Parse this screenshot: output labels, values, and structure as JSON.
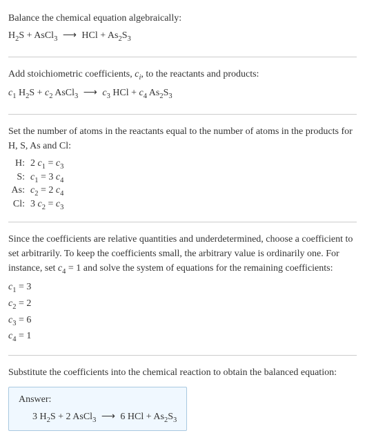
{
  "s1": {
    "heading": "Balance the chemical equation algebraically:",
    "eq_lhs1": "H",
    "eq_lhs1_sub": "2",
    "eq_lhs1b": "S + AsCl",
    "eq_lhs1b_sub": "3",
    "arrow": "⟶",
    "eq_rhs1": "HCl + As",
    "eq_rhs1_sub": "2",
    "eq_rhs1b": "S",
    "eq_rhs1b_sub": "3"
  },
  "s2": {
    "heading_a": "Add stoichiometric coefficients, ",
    "heading_ci": "c",
    "heading_ci_sub": "i",
    "heading_b": ", to the reactants and products:",
    "c1": "c",
    "c1s": "1",
    "t1a": " H",
    "t1as": "2",
    "t1b": "S + ",
    "c2": "c",
    "c2s": "2",
    "t2a": " AsCl",
    "t2as": "3",
    "arrow": "⟶",
    "c3": "c",
    "c3s": "3",
    "t3a": " HCl + ",
    "c4": "c",
    "c4s": "4",
    "t4a": " As",
    "t4as": "2",
    "t4b": "S",
    "t4bs": "3"
  },
  "s3": {
    "heading": "Set the number of atoms in the reactants equal to the number of atoms in the products for H, S, As and Cl:",
    "rows": [
      {
        "el": "H:",
        "lhs_n": "2 ",
        "lhs_c": "c",
        "lhs_s": "1",
        "eq": " = ",
        "rhs_c": "c",
        "rhs_s": "3",
        "rhs_pre": ""
      },
      {
        "el": "S:",
        "lhs_n": "",
        "lhs_c": "c",
        "lhs_s": "1",
        "eq": " = ",
        "rhs_pre": "3 ",
        "rhs_c": "c",
        "rhs_s": "4"
      },
      {
        "el": "As:",
        "lhs_n": "",
        "lhs_c": "c",
        "lhs_s": "2",
        "eq": " = ",
        "rhs_pre": "2 ",
        "rhs_c": "c",
        "rhs_s": "4"
      },
      {
        "el": "Cl:",
        "lhs_n": "3 ",
        "lhs_c": "c",
        "lhs_s": "2",
        "eq": " = ",
        "rhs_pre": "",
        "rhs_c": "c",
        "rhs_s": "3"
      }
    ]
  },
  "s4": {
    "heading_a": "Since the coefficients are relative quantities and underdetermined, choose a coefficient to set arbitrarily. To keep the coefficients small, the arbitrary value is ordinarily one. For instance, set ",
    "heading_c": "c",
    "heading_cs": "4",
    "heading_b": " = 1 and solve the system of equations for the remaining coefficients:",
    "lines": [
      {
        "c": "c",
        "s": "1",
        "v": " = 3"
      },
      {
        "c": "c",
        "s": "2",
        "v": " = 2"
      },
      {
        "c": "c",
        "s": "3",
        "v": " = 6"
      },
      {
        "c": "c",
        "s": "4",
        "v": " = 1"
      }
    ]
  },
  "s5": {
    "heading": "Substitute the coefficients into the chemical reaction to obtain the balanced equation:",
    "answer_label": "Answer:",
    "eq_a": "3 H",
    "eq_as": "2",
    "eq_b": "S + 2 AsCl",
    "eq_bs": "3",
    "arrow": "⟶",
    "eq_c": "6 HCl + As",
    "eq_cs": "2",
    "eq_d": "S",
    "eq_ds": "3"
  }
}
